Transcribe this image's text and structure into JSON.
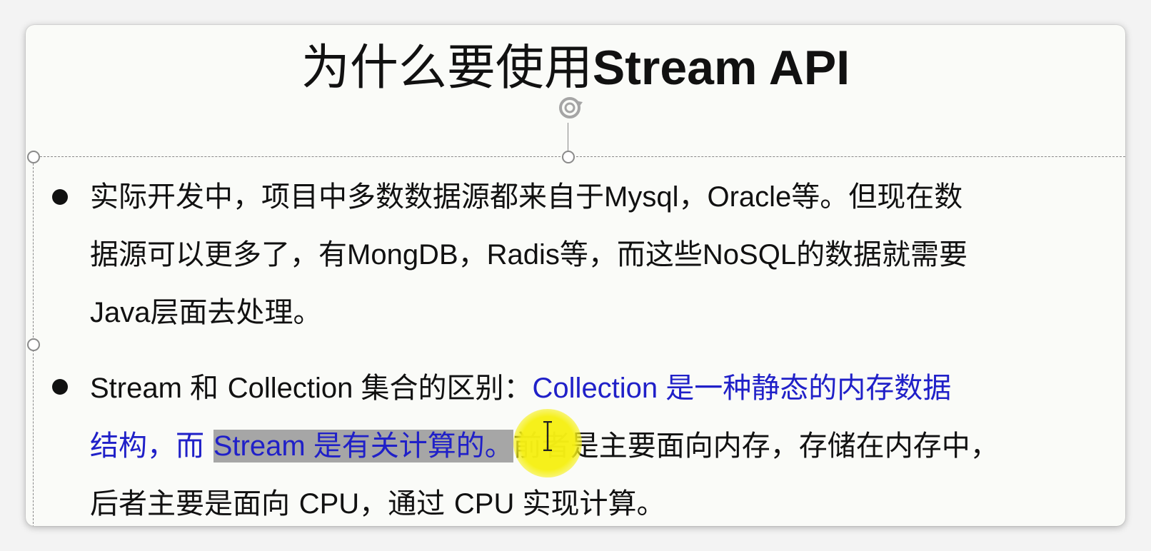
{
  "slide": {
    "title_zh": "为什么要使用",
    "title_en": "Stream API",
    "bullet1": {
      "line1_a": "实际开发中，项目中多数数据源都来自于",
      "line1_b": "Mysql",
      "line1_c": "，",
      "line1_d": "Oracle",
      "line1_e": "等。但现在数",
      "line2_a": "据源可以更多了，有",
      "line2_b": "MongDB",
      "line2_c": "，",
      "line2_d": "Radis",
      "line2_e": "等，而这些",
      "line2_f": "NoSQL",
      "line2_g": "的数据就需要",
      "line3_a": "Java",
      "line3_b": "层面去处理。"
    },
    "bullet2": {
      "l1_a": "Stream ",
      "l1_b": "和 ",
      "l1_c": "Collection ",
      "l1_d": "集合的区别：",
      "l1_e": "Collection ",
      "l1_f": "是一种静态的内存数据",
      "l2_a": "结构，而 ",
      "l2_b": "Stream ",
      "l2_c": "是有关计算的",
      "l2_d": "。",
      "l2_e": "前者是主要面向内存，存储在内存中，",
      "l3_a": "后者主要是面向 ",
      "l3_b": "CPU",
      "l3_c": "，通过 ",
      "l3_d": "CPU ",
      "l3_e": "实现计算。"
    }
  },
  "colors": {
    "highlight_text": "#2020c8",
    "selection": "#a6a6a6",
    "cursor_halo": "#f6f014"
  },
  "icons": {
    "rotate": "rotate-handle-icon",
    "cursor": "text-cursor-icon"
  }
}
